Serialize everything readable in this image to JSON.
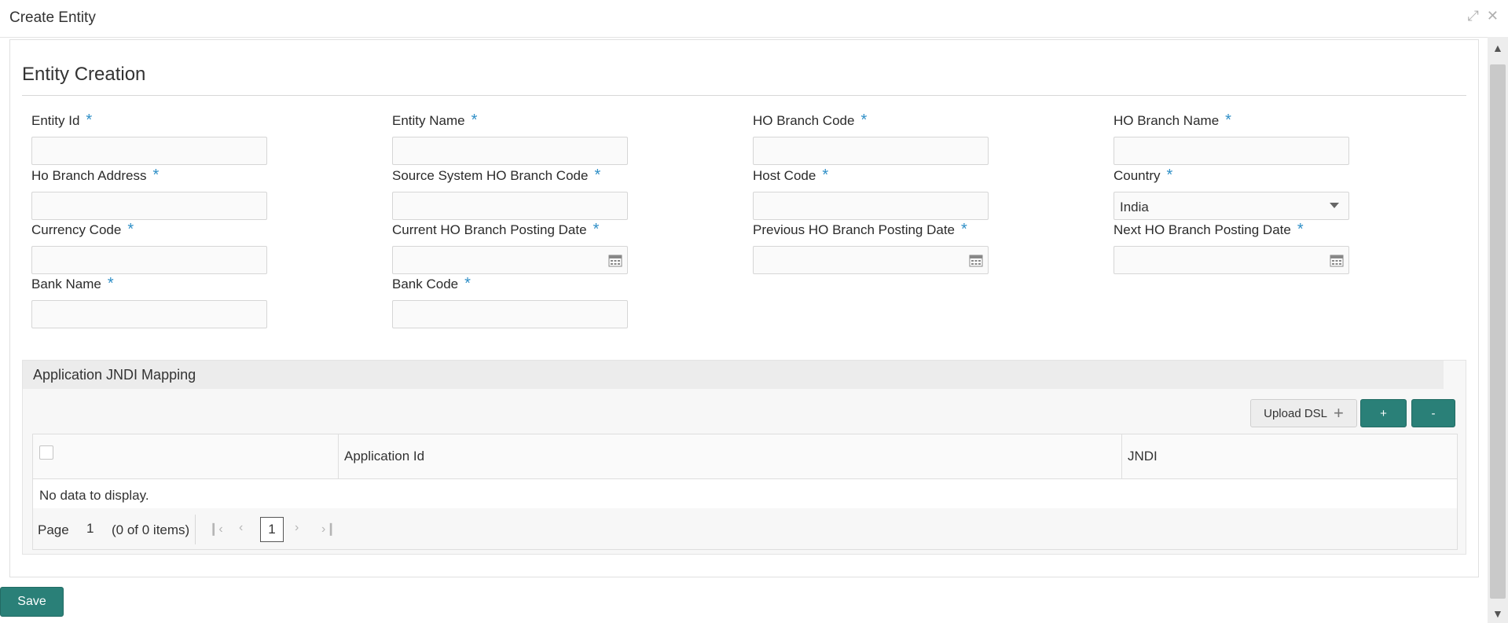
{
  "window": {
    "title": "Create Entity"
  },
  "section": {
    "title": "Entity Creation"
  },
  "fields": {
    "entity_id": {
      "label": "Entity Id",
      "value": ""
    },
    "entity_name": {
      "label": "Entity Name",
      "value": ""
    },
    "ho_branch_code": {
      "label": "HO Branch Code",
      "value": ""
    },
    "ho_branch_name": {
      "label": "HO Branch Name",
      "value": ""
    },
    "ho_branch_address": {
      "label": "Ho Branch Address",
      "value": ""
    },
    "source_system_ho_branch_code": {
      "label": "Source System HO Branch Code",
      "value": ""
    },
    "host_code": {
      "label": "Host Code",
      "value": ""
    },
    "country": {
      "label": "Country",
      "value": "India"
    },
    "currency_code": {
      "label": "Currency Code",
      "value": ""
    },
    "current_ho_branch_posting_date": {
      "label": "Current HO Branch Posting Date",
      "value": ""
    },
    "previous_ho_branch_posting_date": {
      "label": "Previous HO Branch Posting Date",
      "value": ""
    },
    "next_ho_branch_posting_date": {
      "label": "Next HO Branch Posting Date",
      "value": ""
    },
    "bank_name": {
      "label": "Bank Name",
      "value": ""
    },
    "bank_code": {
      "label": "Bank Code",
      "value": ""
    }
  },
  "required_marker": "*",
  "jndi": {
    "title": "Application JNDI Mapping",
    "upload_label": "Upload DSL",
    "add_label": "+",
    "remove_label": "-",
    "columns": [
      "Application Id",
      "JNDI"
    ],
    "empty_text": "No data to display.",
    "pager": {
      "page_label": "Page",
      "page_value": "1",
      "count_text": "(0 of 0 items)",
      "current_page": "1"
    }
  },
  "footer": {
    "save_label": "Save"
  },
  "colors": {
    "primary": "#2a8078",
    "required": "#2f8fc7"
  },
  "icons": [
    "minimize-icon",
    "close-icon",
    "calendar-icon",
    "dropdown-caret-icon",
    "first-page-icon",
    "prev-page-icon",
    "next-page-icon",
    "last-page-icon"
  ]
}
